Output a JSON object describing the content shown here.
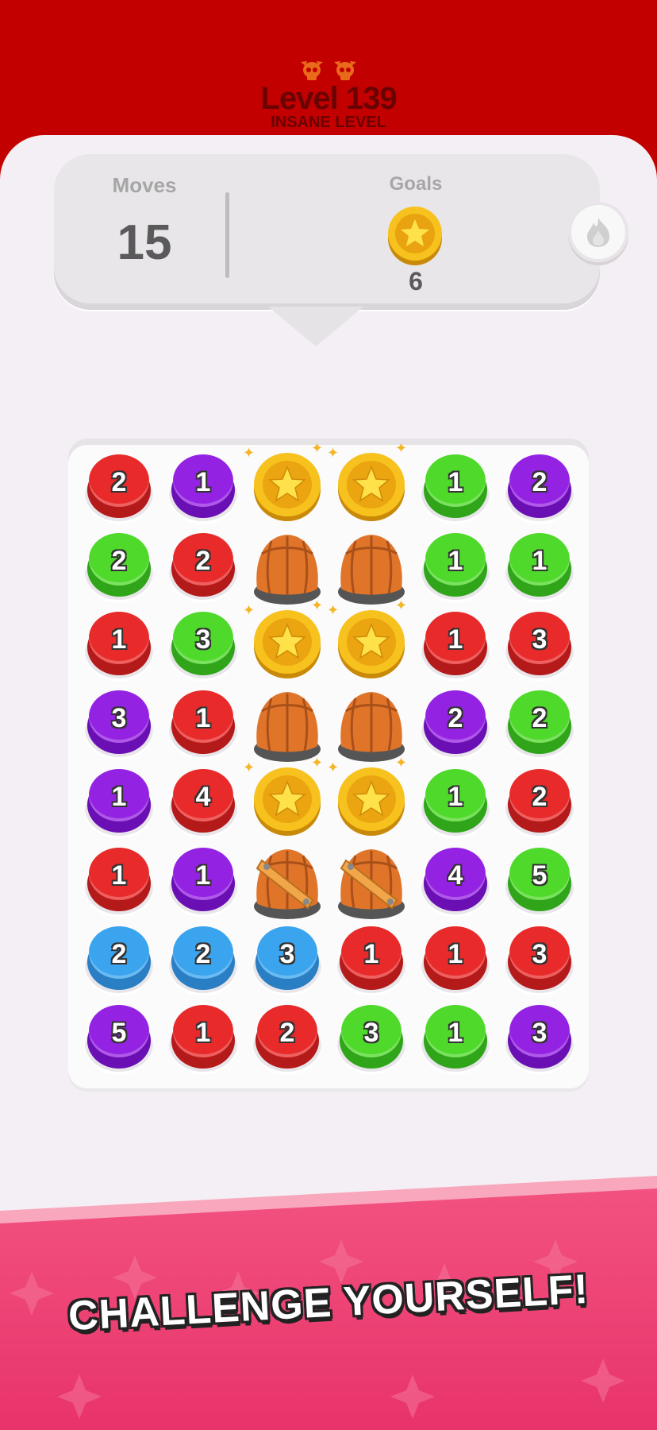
{
  "header": {
    "level_title": "Level 139",
    "level_subtitle": "INSANE LEVEL",
    "difficulty_icons": [
      "skull-icon",
      "skull-icon"
    ]
  },
  "hud": {
    "moves_label": "Moves",
    "moves_value": "15",
    "goals_label": "Goals",
    "goal_icon": "star-coin-icon",
    "goal_count": "6",
    "booster_icon": "flame-icon"
  },
  "board": {
    "rows": [
      [
        {
          "t": "btn",
          "c": "red",
          "n": "2"
        },
        {
          "t": "btn",
          "c": "purple",
          "n": "1"
        },
        {
          "t": "coin"
        },
        {
          "t": "coin"
        },
        {
          "t": "btn",
          "c": "green",
          "n": "1"
        },
        {
          "t": "btn",
          "c": "purple",
          "n": "2"
        }
      ],
      [
        {
          "t": "btn",
          "c": "green",
          "n": "2"
        },
        {
          "t": "btn",
          "c": "red",
          "n": "2"
        },
        {
          "t": "barrel"
        },
        {
          "t": "barrel"
        },
        {
          "t": "btn",
          "c": "green",
          "n": "1"
        },
        {
          "t": "btn",
          "c": "green",
          "n": "1"
        }
      ],
      [
        {
          "t": "btn",
          "c": "red",
          "n": "1"
        },
        {
          "t": "btn",
          "c": "green",
          "n": "3"
        },
        {
          "t": "coin"
        },
        {
          "t": "coin"
        },
        {
          "t": "btn",
          "c": "red",
          "n": "1"
        },
        {
          "t": "btn",
          "c": "red",
          "n": "3"
        }
      ],
      [
        {
          "t": "btn",
          "c": "purple",
          "n": "3"
        },
        {
          "t": "btn",
          "c": "red",
          "n": "1"
        },
        {
          "t": "barrel"
        },
        {
          "t": "barrel"
        },
        {
          "t": "btn",
          "c": "purple",
          "n": "2"
        },
        {
          "t": "btn",
          "c": "green",
          "n": "2"
        }
      ],
      [
        {
          "t": "btn",
          "c": "purple",
          "n": "1"
        },
        {
          "t": "btn",
          "c": "red",
          "n": "4"
        },
        {
          "t": "coin"
        },
        {
          "t": "coin"
        },
        {
          "t": "btn",
          "c": "green",
          "n": "1"
        },
        {
          "t": "btn",
          "c": "red",
          "n": "2"
        }
      ],
      [
        {
          "t": "btn",
          "c": "red",
          "n": "1"
        },
        {
          "t": "btn",
          "c": "purple",
          "n": "1"
        },
        {
          "t": "barrel",
          "strap": true
        },
        {
          "t": "barrel",
          "strap": true
        },
        {
          "t": "btn",
          "c": "purple",
          "n": "4"
        },
        {
          "t": "btn",
          "c": "green",
          "n": "5"
        }
      ],
      [
        {
          "t": "btn",
          "c": "blue",
          "n": "2"
        },
        {
          "t": "btn",
          "c": "blue",
          "n": "2"
        },
        {
          "t": "btn",
          "c": "blue",
          "n": "3"
        },
        {
          "t": "btn",
          "c": "red",
          "n": "1"
        },
        {
          "t": "btn",
          "c": "red",
          "n": "1"
        },
        {
          "t": "btn",
          "c": "red",
          "n": "3"
        }
      ],
      [
        {
          "t": "btn",
          "c": "purple",
          "n": "5"
        },
        {
          "t": "btn",
          "c": "red",
          "n": "1"
        },
        {
          "t": "btn",
          "c": "red",
          "n": "2"
        },
        {
          "t": "btn",
          "c": "green",
          "n": "3"
        },
        {
          "t": "btn",
          "c": "green",
          "n": "1"
        },
        {
          "t": "btn",
          "c": "purple",
          "n": "3"
        }
      ]
    ]
  },
  "banner": {
    "text": "CHALLENGE YOURSELF!"
  }
}
